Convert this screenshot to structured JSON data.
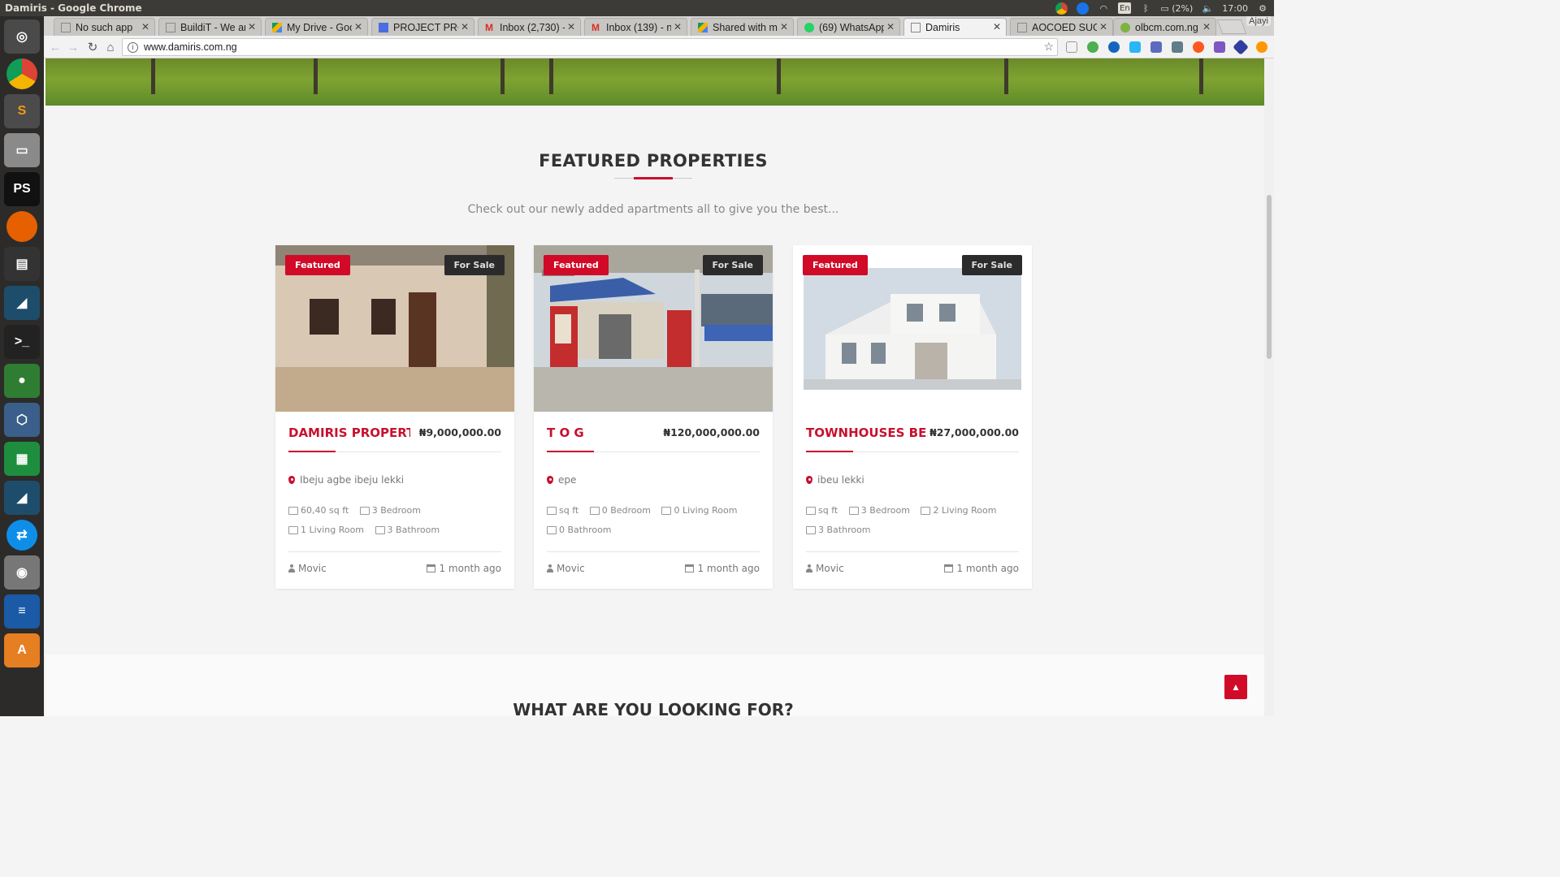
{
  "os": {
    "window_title": "Damiris - Google Chrome",
    "tray": {
      "lang": "En",
      "battery": "(2%)",
      "time": "17:00"
    }
  },
  "browser": {
    "tabs": [
      {
        "label": "No such app",
        "active": false
      },
      {
        "label": "BuildiT - We ar",
        "active": false
      },
      {
        "label": "My Drive - Goo",
        "active": false
      },
      {
        "label": "PROJECT PRO",
        "active": false
      },
      {
        "label": "Inbox (2,730) -",
        "active": false
      },
      {
        "label": "Inbox (139) - n",
        "active": false
      },
      {
        "label": "Shared with m",
        "active": false
      },
      {
        "label": "(69) WhatsApp",
        "active": false
      },
      {
        "label": "Damiris",
        "active": true
      },
      {
        "label": "AOCOED SUG",
        "active": false
      },
      {
        "label": "olbcm.com.ng",
        "active": false
      }
    ],
    "profile": "Ajayi",
    "url": "www.damiris.com.ng"
  },
  "page": {
    "featured": {
      "title": "FEATURED PROPERTIES",
      "subtitle": "Check out our newly added apartments all to give you the best..."
    },
    "properties": [
      {
        "badge_featured": "Featured",
        "badge_status": "For Sale",
        "name": "DAMIRIS PROPERT...",
        "price": "₦9,000,000.00",
        "location": "Ibeju agbe ibeju lekki",
        "area": "60,40 sq ft",
        "bedrooms": "3 Bedroom",
        "living": "1 Living Room",
        "bathrooms": "3 Bathroom",
        "author": "Movic",
        "date": "1 month ago"
      },
      {
        "badge_featured": "Featured",
        "badge_status": "For Sale",
        "name": "T O G",
        "price": "₦120,000,000.00",
        "location": "epe",
        "area": "sq ft",
        "bedrooms": "0 Bedroom",
        "living": "0 Living Room",
        "bathrooms": "0 Bathroom",
        "author": "Movic",
        "date": "1 month ago"
      },
      {
        "badge_featured": "Featured",
        "badge_status": "For Sale",
        "name": "TOWNHOUSES BE...",
        "price": "₦27,000,000.00",
        "location": "ibeu lekki",
        "area": "sq ft",
        "bedrooms": "3 Bedroom",
        "living": "2 Living Room",
        "bathrooms": "3 Bathroom",
        "author": "Movic",
        "date": "1 month ago"
      }
    ],
    "next_section_title": "WHAT ARE YOU LOOKING FOR?"
  },
  "colors": {
    "accent": "#c8102e",
    "badge_dark": "#2b2b2b"
  }
}
